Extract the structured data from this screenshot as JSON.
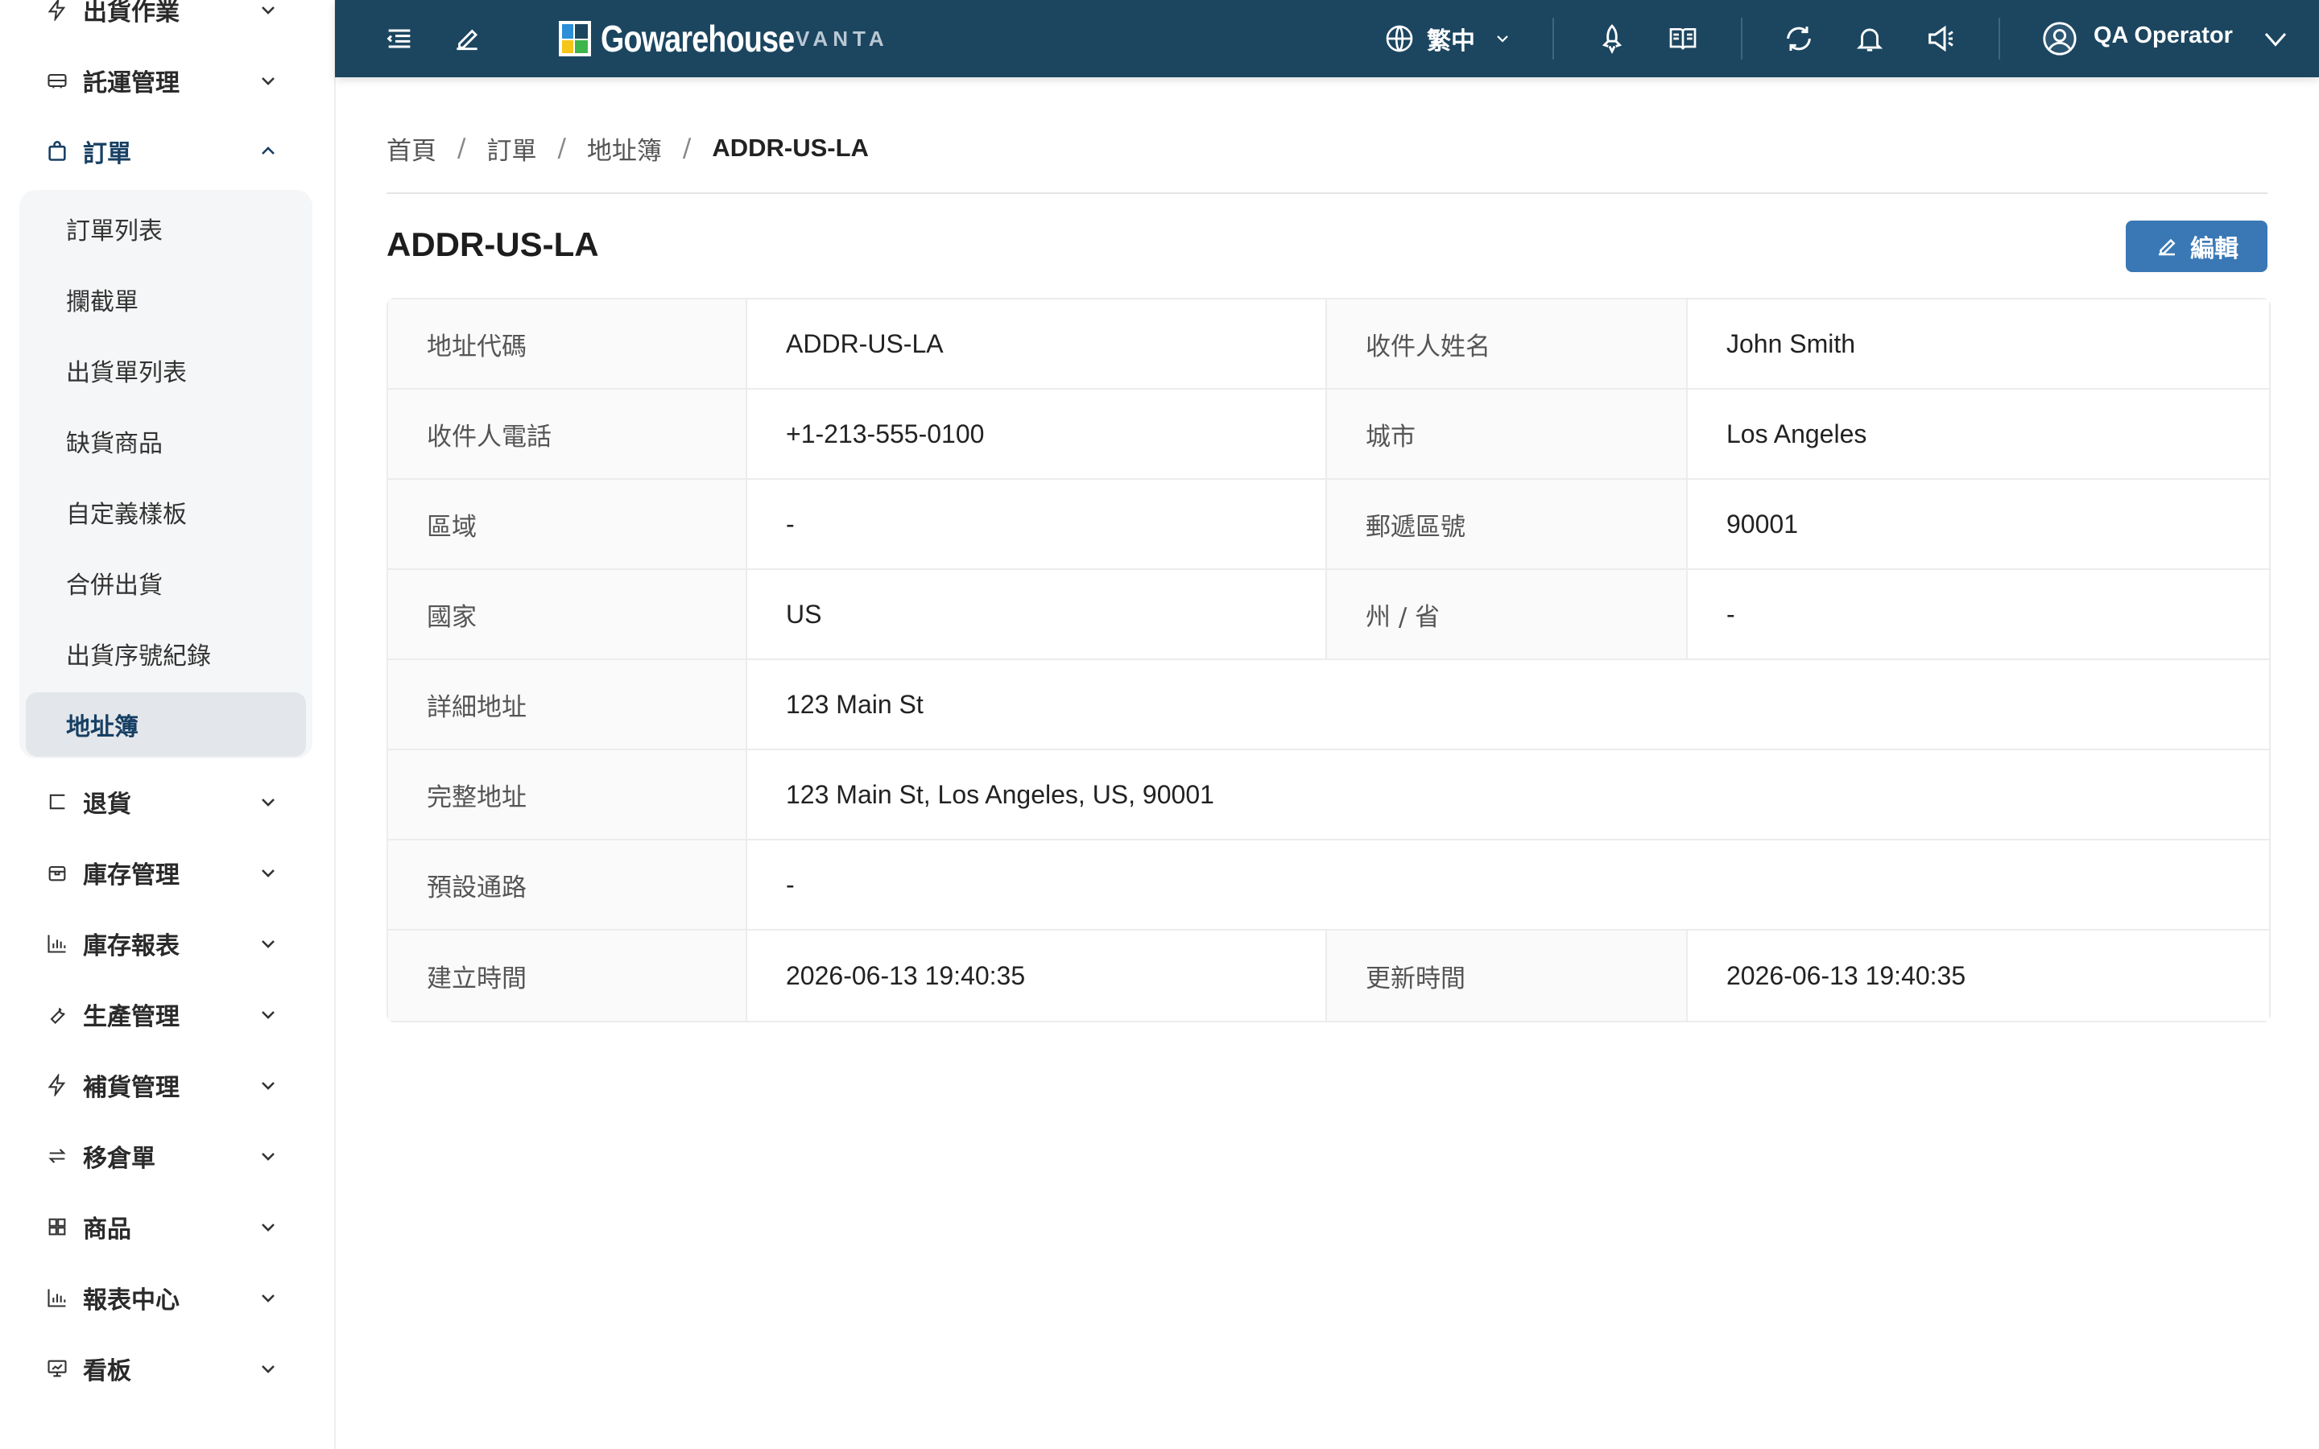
{
  "sidebar": {
    "items": [
      {
        "label": "出貨作業",
        "icon": "bolt-icon"
      },
      {
        "label": "託運管理",
        "icon": "truck-icon"
      },
      {
        "label": "訂單",
        "icon": "bag-icon",
        "open": true
      },
      {
        "label": "退貨",
        "icon": "return-icon"
      },
      {
        "label": "庫存管理",
        "icon": "box-icon"
      },
      {
        "label": "庫存報表",
        "icon": "bar-chart-icon"
      },
      {
        "label": "生產管理",
        "icon": "wrench-icon"
      },
      {
        "label": "補貨管理",
        "icon": "bolt-icon"
      },
      {
        "label": "移倉單",
        "icon": "swap-icon"
      },
      {
        "label": "商品",
        "icon": "grid-icon"
      },
      {
        "label": "報表中心",
        "icon": "bar-chart-icon"
      },
      {
        "label": "看板",
        "icon": "dashboard-icon"
      }
    ],
    "order_submenu": [
      {
        "label": "訂單列表"
      },
      {
        "label": "攔截單"
      },
      {
        "label": "出貨單列表"
      },
      {
        "label": "缺貨商品"
      },
      {
        "label": "自定義樣板"
      },
      {
        "label": "合併出貨"
      },
      {
        "label": "出貨序號紀錄"
      },
      {
        "label": "地址簿",
        "active": true
      }
    ]
  },
  "topbar": {
    "logo_text": "Gowarehouse",
    "logo_sub": "VANTA",
    "language": "繁中",
    "user": "QA Operator",
    "bg_color": "#1c4660"
  },
  "breadcrumb": {
    "items": [
      "首頁",
      "訂單",
      "地址簿"
    ],
    "current": "ADDR-US-LA"
  },
  "page": {
    "title": "ADDR-US-LA",
    "edit_label": "編輯"
  },
  "details": {
    "address_code": {
      "label": "地址代碼",
      "value": "ADDR-US-LA"
    },
    "recipient_name": {
      "label": "收件人姓名",
      "value": "John Smith"
    },
    "recipient_phone": {
      "label": "收件人電話",
      "value": "+1-213-555-0100"
    },
    "city": {
      "label": "城市",
      "value": "Los Angeles"
    },
    "district": {
      "label": "區域",
      "value": "-"
    },
    "postal_code": {
      "label": "郵遞區號",
      "value": "90001"
    },
    "country": {
      "label": "國家",
      "value": "US"
    },
    "state": {
      "label": "州 / 省",
      "value": "-"
    },
    "detail_address": {
      "label": "詳細地址",
      "value": "123 Main St"
    },
    "full_address": {
      "label": "完整地址",
      "value": "123 Main St, Los Angeles, US, 90001"
    },
    "default_channel": {
      "label": "預設通路",
      "value": "-"
    },
    "created_at": {
      "label": "建立時間",
      "value": "2026-06-13 19:40:35"
    },
    "updated_at": {
      "label": "更新時間",
      "value": "2026-06-13 19:40:35"
    }
  },
  "colors": {
    "accent": "#3a78b5",
    "active_text": "#173f63"
  }
}
